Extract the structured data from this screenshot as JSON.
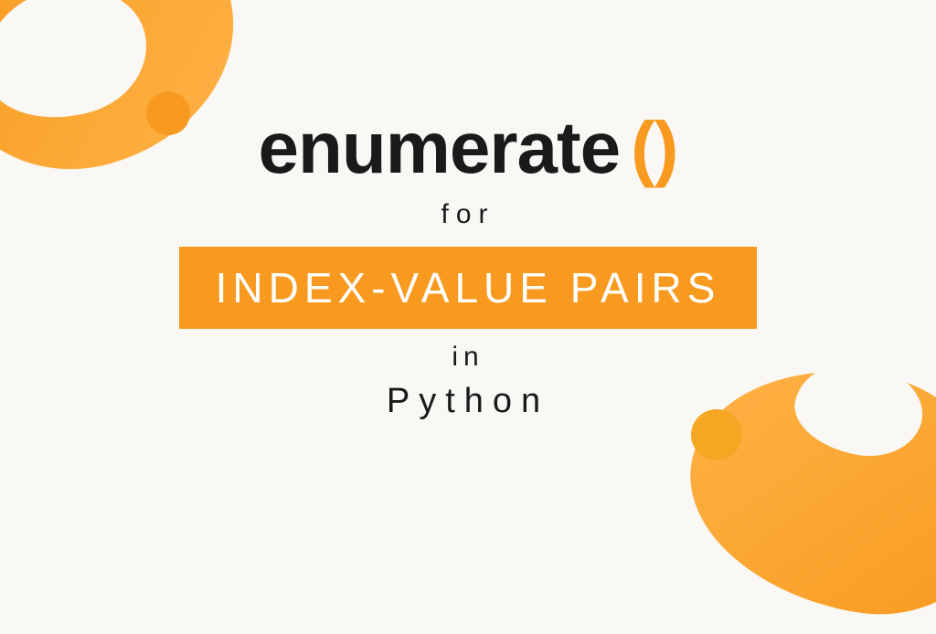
{
  "title": {
    "function_name": "enumerate",
    "parens": "()"
  },
  "subtitle_for": "for",
  "banner_text": "INDEX-VALUE PAIRS",
  "subtitle_in": "in",
  "language": "Python",
  "colors": {
    "accent": "#f79a1f",
    "background": "#faf8f5",
    "text": "#1a1a1a",
    "banner_text": "#ffffff"
  }
}
